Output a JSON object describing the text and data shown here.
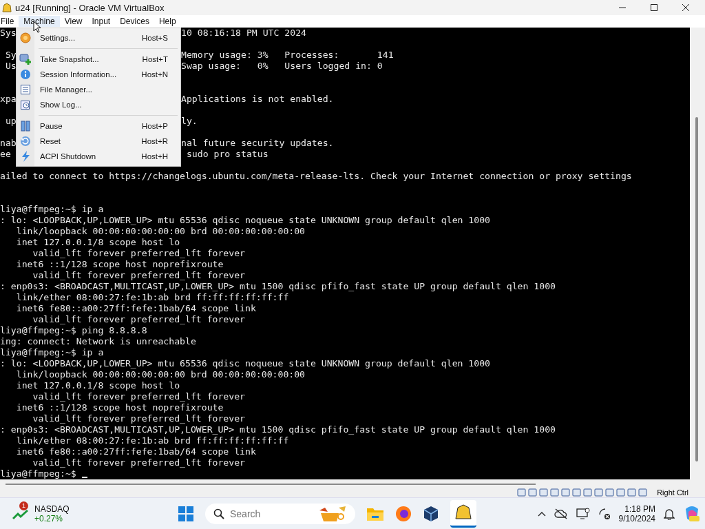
{
  "window": {
    "title": "u24 [Running] - Oracle VM VirtualBox"
  },
  "menubar": [
    {
      "label": "File",
      "selected": false
    },
    {
      "label": "Machine",
      "selected": true
    },
    {
      "label": "View",
      "selected": false
    },
    {
      "label": "Input",
      "selected": false
    },
    {
      "label": "Devices",
      "selected": false
    },
    {
      "label": "Help",
      "selected": false
    }
  ],
  "menu": [
    {
      "kind": "item",
      "label": "Settings...",
      "shortcut": "Host+S"
    },
    {
      "kind": "separator"
    },
    {
      "kind": "item",
      "label": "Take Snapshot...",
      "shortcut": "Host+T"
    },
    {
      "kind": "item",
      "label": "Session Information...",
      "shortcut": "Host+N"
    },
    {
      "kind": "item",
      "label": "File Manager..."
    },
    {
      "kind": "item",
      "label": "Show Log..."
    },
    {
      "kind": "separator"
    },
    {
      "kind": "item",
      "label": "Pause",
      "shortcut": "Host+P"
    },
    {
      "kind": "item",
      "label": "Reset",
      "shortcut": "Host+R"
    },
    {
      "kind": "item",
      "label": "ACPI Shutdown",
      "shortcut": "Host+H"
    }
  ],
  "terminal": [
    {
      "kind": "split",
      "left": "Sys",
      "right": "10 08:16:18 PM UTC 2024"
    },
    {
      "kind": "blank"
    },
    {
      "kind": "split",
      "left": " Sy",
      "right": "Memory usage: 3%   Processes:       141"
    },
    {
      "kind": "split",
      "left": " Us",
      "right": "Swap usage:   0%   Users logged in: 0"
    },
    {
      "kind": "blank"
    },
    {
      "kind": "blank"
    },
    {
      "kind": "split",
      "left": "xpa",
      "right": "Applications is not enabled."
    },
    {
      "kind": "blank"
    },
    {
      "kind": "split",
      "left": " up",
      "right": "ly."
    },
    {
      "kind": "blank"
    },
    {
      "kind": "split",
      "left": "nab",
      "right": "nal future security updates."
    },
    {
      "kind": "split",
      "left": "ee",
      "right": " sudo pro status"
    },
    {
      "kind": "blank"
    },
    {
      "kind": "text",
      "text": "ailed to connect to https://changelogs.ubuntu.com/meta-release-lts. Check your Internet connection or proxy settings"
    },
    {
      "kind": "blank"
    },
    {
      "kind": "blank"
    },
    {
      "kind": "text",
      "text": "liya@ffmpeg:~$ ip a"
    },
    {
      "kind": "text",
      "text": ": lo: <LOOPBACK,UP,LOWER_UP> mtu 65536 qdisc noqueue state UNKNOWN group default qlen 1000"
    },
    {
      "kind": "text",
      "text": "   link/loopback 00:00:00:00:00:00 brd 00:00:00:00:00:00"
    },
    {
      "kind": "text",
      "text": "   inet 127.0.0.1/8 scope host lo"
    },
    {
      "kind": "text",
      "text": "      valid_lft forever preferred_lft forever"
    },
    {
      "kind": "text",
      "text": "   inet6 ::1/128 scope host noprefixroute"
    },
    {
      "kind": "text",
      "text": "      valid_lft forever preferred_lft forever"
    },
    {
      "kind": "text",
      "text": ": enp0s3: <BROADCAST,MULTICAST,UP,LOWER_UP> mtu 1500 qdisc pfifo_fast state UP group default qlen 1000"
    },
    {
      "kind": "text",
      "text": "   link/ether 08:00:27:fe:1b:ab brd ff:ff:ff:ff:ff:ff"
    },
    {
      "kind": "text",
      "text": "   inet6 fe80::a00:27ff:fefe:1bab/64 scope link"
    },
    {
      "kind": "text",
      "text": "      valid_lft forever preferred_lft forever"
    },
    {
      "kind": "text",
      "text": "liya@ffmpeg:~$ ping 8.8.8.8"
    },
    {
      "kind": "text",
      "text": "ing: connect: Network is unreachable"
    },
    {
      "kind": "text",
      "text": "liya@ffmpeg:~$ ip a"
    },
    {
      "kind": "text",
      "text": ": lo: <LOOPBACK,UP,LOWER_UP> mtu 65536 qdisc noqueue state UNKNOWN group default qlen 1000"
    },
    {
      "kind": "text",
      "text": "   link/loopback 00:00:00:00:00:00 brd 00:00:00:00:00:00"
    },
    {
      "kind": "text",
      "text": "   inet 127.0.0.1/8 scope host lo"
    },
    {
      "kind": "text",
      "text": "      valid_lft forever preferred_lft forever"
    },
    {
      "kind": "text",
      "text": "   inet6 ::1/128 scope host noprefixroute"
    },
    {
      "kind": "text",
      "text": "      valid_lft forever preferred_lft forever"
    },
    {
      "kind": "text",
      "text": ": enp0s3: <BROADCAST,MULTICAST,UP,LOWER_UP> mtu 1500 qdisc pfifo_fast state UP group default qlen 1000"
    },
    {
      "kind": "text",
      "text": "   link/ether 08:00:27:fe:1b:ab brd ff:ff:ff:ff:ff:ff"
    },
    {
      "kind": "text",
      "text": "   inet6 fe80::a00:27ff:fefe:1bab/64 scope link"
    },
    {
      "kind": "text",
      "text": "      valid_lft forever preferred_lft forever"
    },
    {
      "kind": "prompt",
      "text": "liya@ffmpeg:~$ "
    }
  ],
  "status_bar": {
    "host_key": "Right Ctrl"
  },
  "taskbar": {
    "widget": {
      "name": "NASDAQ",
      "change": "+0.27%",
      "badge": "1"
    },
    "search": {
      "placeholder": "Search"
    },
    "time": "1:18 PM",
    "date": "9/10/2024"
  }
}
